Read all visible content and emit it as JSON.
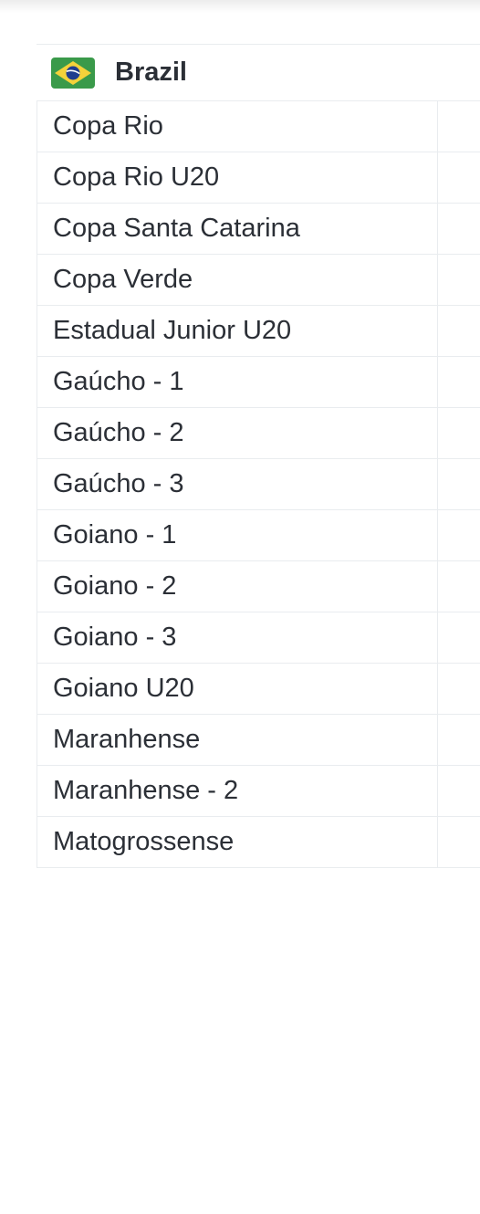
{
  "country": {
    "name": "Brazil",
    "flag_icon": "brazil-flag-icon",
    "flag_colors": {
      "green": "#3a9a4a",
      "yellow": "#f4d23a",
      "blue": "#1f3d8f",
      "white": "#ffffff"
    }
  },
  "leagues": [
    {
      "label": "Copa Rio"
    },
    {
      "label": "Copa Rio U20"
    },
    {
      "label": "Copa Santa Catarina"
    },
    {
      "label": "Copa Verde"
    },
    {
      "label": "Estadual Junior U20"
    },
    {
      "label": "Gaúcho - 1"
    },
    {
      "label": "Gaúcho - 2"
    },
    {
      "label": "Gaúcho - 3"
    },
    {
      "label": "Goiano - 1"
    },
    {
      "label": "Goiano - 2"
    },
    {
      "label": "Goiano - 3"
    },
    {
      "label": "Goiano U20"
    },
    {
      "label": "Maranhense"
    },
    {
      "label": "Maranhense - 2"
    },
    {
      "label": "Matogrossense"
    }
  ]
}
